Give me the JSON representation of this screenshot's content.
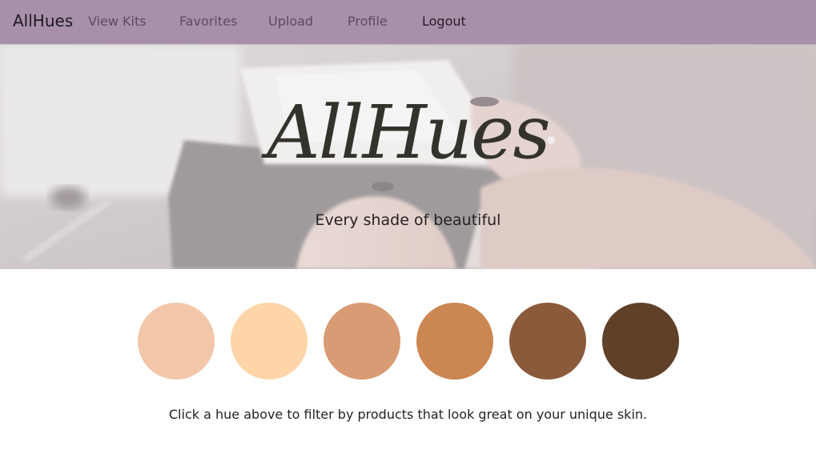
{
  "navbar": {
    "brand": "AllHues",
    "links": [
      "View Kits",
      "Favorites",
      "Upload",
      "Profile",
      "Logout"
    ],
    "background": "#a890aa"
  },
  "hero": {
    "title": "AllHues",
    "tagline": "Every shade of beautiful"
  },
  "hues": [
    {
      "color": "#f2c6a8"
    },
    {
      "color": "#fdd5a8"
    },
    {
      "color": "#d99b74"
    },
    {
      "color": "#cc8652"
    },
    {
      "color": "#8a5a3b"
    },
    {
      "color": "#5f4029"
    }
  ],
  "hint": "Click a hue above to filter by products that look great on your unique skin."
}
